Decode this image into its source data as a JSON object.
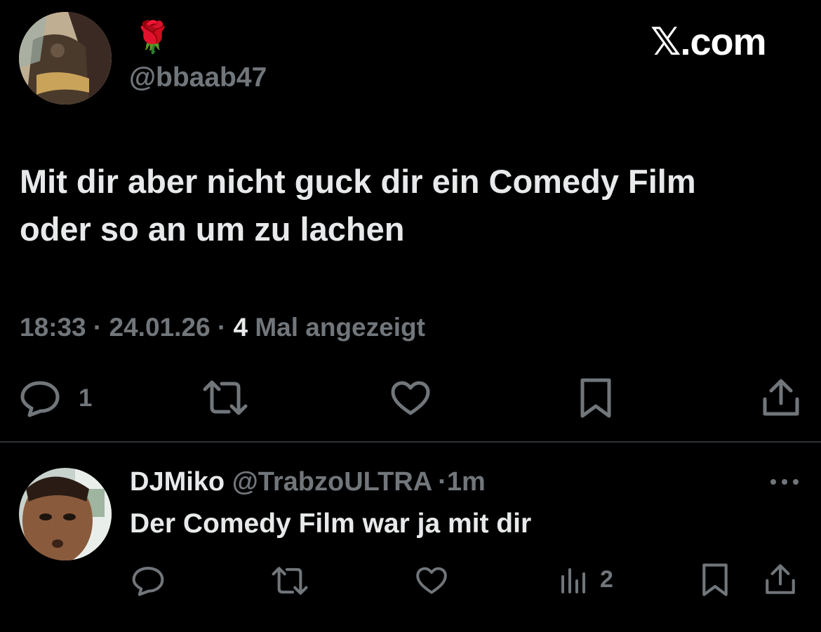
{
  "main_tweet": {
    "display_name_emoji": "🌹",
    "handle": "@bbaab47",
    "text_line1": "Mit dir aber nicht guck dir ein Comedy Film",
    "text_line2": "oder so an um zu lachen",
    "time": "18:33",
    "dot1": "·",
    "date": "24.01.26",
    "dot2": "·",
    "views_count": "4",
    "views_label": "Mal angezeigt",
    "reply_count": "1"
  },
  "watermark": "𝕏.com",
  "reply_tweet": {
    "display_name": "DJMiko",
    "handle": "@TrabzoULTRA",
    "dot": "·",
    "age": "1m",
    "text": "Der Comedy Film war ja mit dir",
    "views_count": "2"
  },
  "colors": {
    "background": "#000000",
    "text": "#e7e9ea",
    "muted": "#71767b",
    "divider": "#2f3336"
  }
}
